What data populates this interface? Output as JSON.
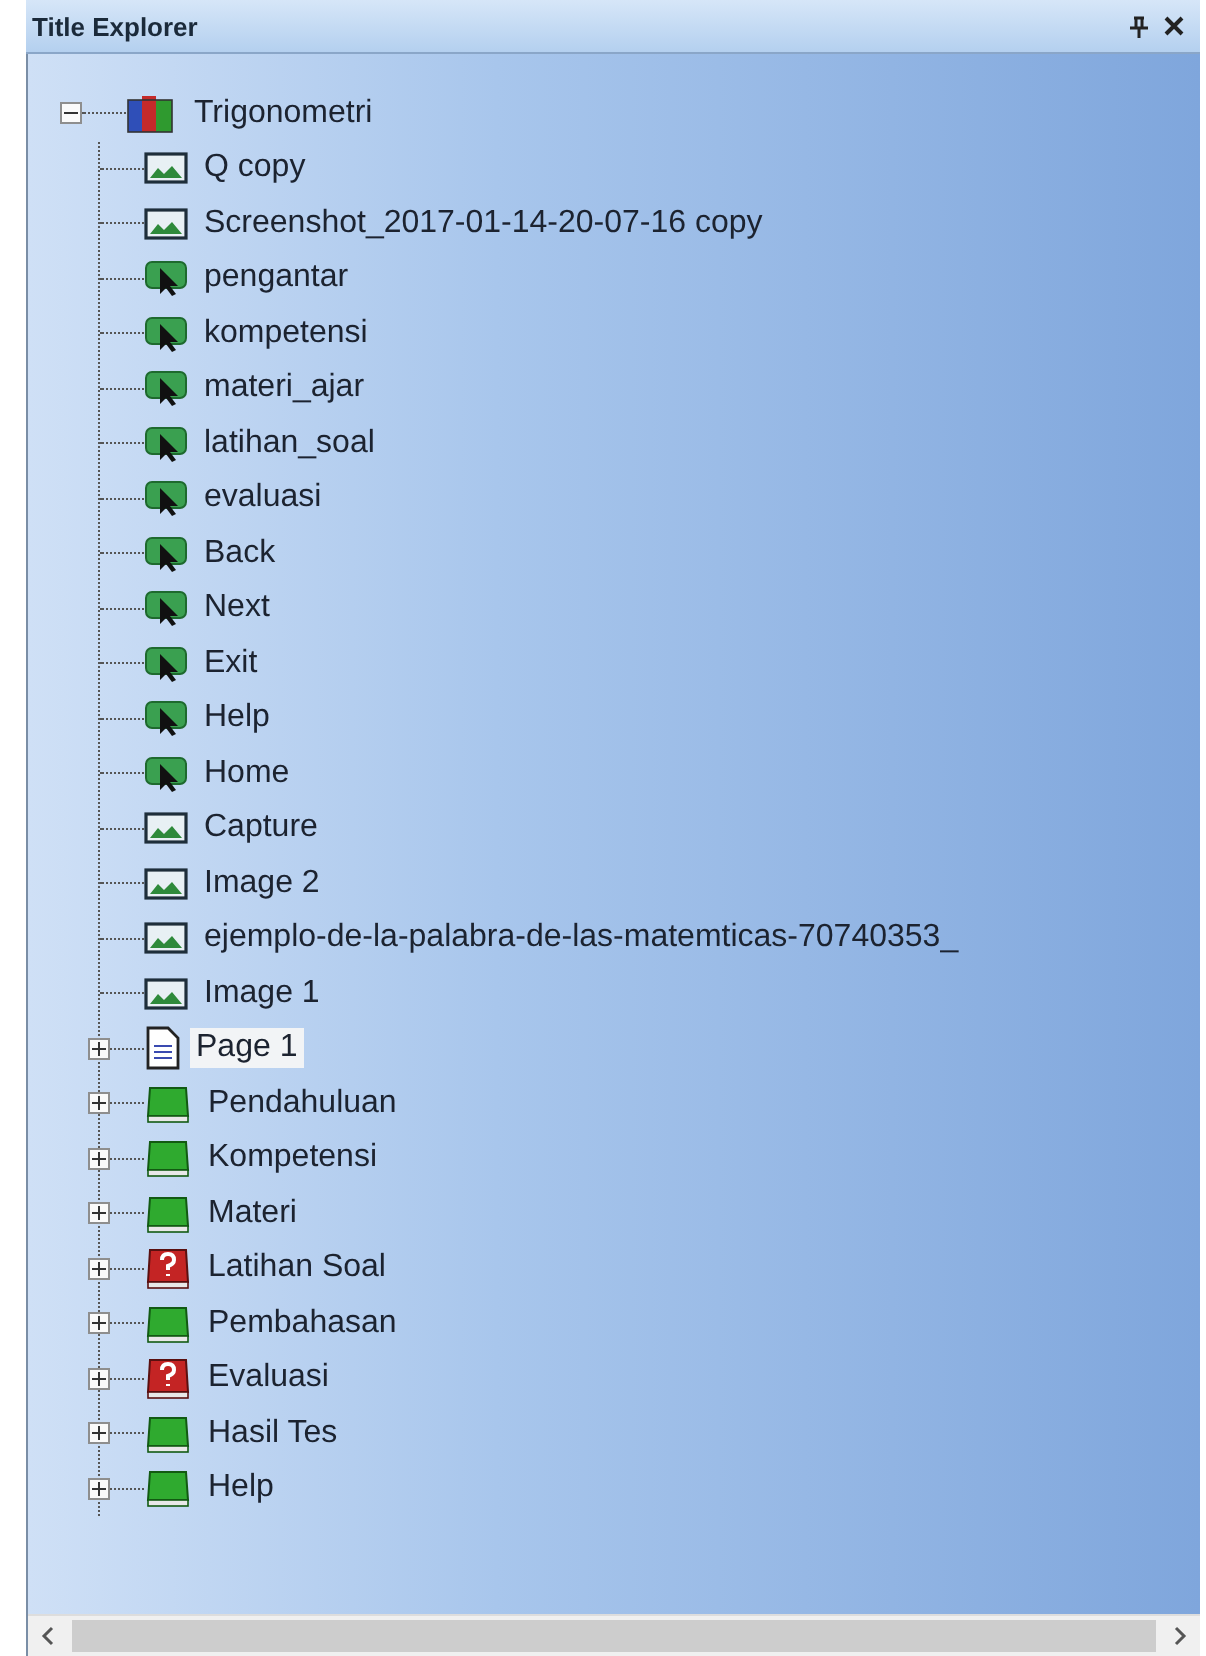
{
  "panel": {
    "title": "Title Explorer"
  },
  "tree": {
    "label": "Trigonometri",
    "kind": "title",
    "expanded": true,
    "selected": false,
    "children": [
      {
        "label": "Q copy",
        "kind": "image",
        "selected": false
      },
      {
        "label": "Screenshot_2017-01-14-20-07-16 copy",
        "kind": "image",
        "selected": false
      },
      {
        "label": "pengantar",
        "kind": "button",
        "selected": false
      },
      {
        "label": "kompetensi",
        "kind": "button",
        "selected": false
      },
      {
        "label": "materi_ajar",
        "kind": "button",
        "selected": false
      },
      {
        "label": "latihan_soal",
        "kind": "button",
        "selected": false
      },
      {
        "label": "evaluasi",
        "kind": "button",
        "selected": false
      },
      {
        "label": "Back",
        "kind": "button",
        "selected": false
      },
      {
        "label": "Next",
        "kind": "button",
        "selected": false
      },
      {
        "label": "Exit",
        "kind": "button",
        "selected": false
      },
      {
        "label": "Help",
        "kind": "button",
        "selected": false
      },
      {
        "label": "Home",
        "kind": "button",
        "selected": false
      },
      {
        "label": "Capture",
        "kind": "image",
        "selected": false
      },
      {
        "label": "Image 2",
        "kind": "image",
        "selected": false
      },
      {
        "label": "ejemplo-de-la-palabra-de-las-matemticas-70740353_",
        "kind": "image",
        "selected": false
      },
      {
        "label": "Image 1",
        "kind": "image",
        "selected": false
      },
      {
        "label": "Page 1",
        "kind": "page",
        "expanded": false,
        "selected": true
      },
      {
        "label": "Pendahuluan",
        "kind": "chapter",
        "expanded": false,
        "selected": false
      },
      {
        "label": "Kompetensi",
        "kind": "chapter",
        "expanded": false,
        "selected": false
      },
      {
        "label": "Materi",
        "kind": "chapter",
        "expanded": false,
        "selected": false
      },
      {
        "label": "Latihan Soal",
        "kind": "quiz",
        "expanded": false,
        "selected": false
      },
      {
        "label": "Pembahasan",
        "kind": "chapter",
        "expanded": false,
        "selected": false
      },
      {
        "label": "Evaluasi",
        "kind": "quiz",
        "expanded": false,
        "selected": false
      },
      {
        "label": "Hasil Tes",
        "kind": "chapter",
        "expanded": false,
        "selected": false
      },
      {
        "label": "Help",
        "kind": "chapter",
        "expanded": false,
        "selected": false
      }
    ]
  }
}
